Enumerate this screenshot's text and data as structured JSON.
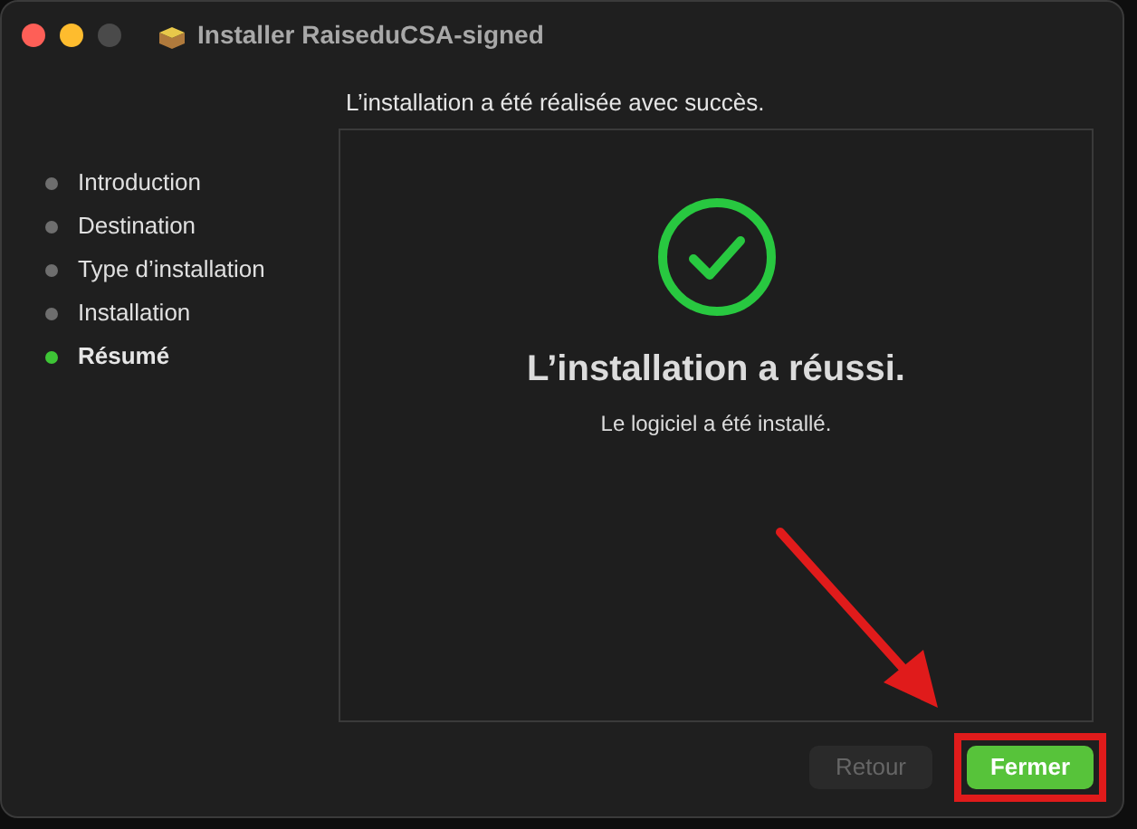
{
  "window": {
    "title": "Installer RaiseduCSA-signed"
  },
  "sidebar": {
    "items": [
      {
        "label": "Introduction",
        "selected": false
      },
      {
        "label": "Destination",
        "selected": false
      },
      {
        "label": "Type d’installation",
        "selected": false
      },
      {
        "label": "Installation",
        "selected": false
      },
      {
        "label": "Résumé",
        "selected": true
      }
    ]
  },
  "header": "L’installation a été réalisée avec succès.",
  "result": {
    "title": "L’installation a réussi.",
    "message": "Le logiciel a été installé."
  },
  "buttons": [
    {
      "label": "Retour",
      "disabled": true,
      "highlighted": false
    },
    {
      "label": "Fermer",
      "disabled": false,
      "highlighted": true
    }
  ]
}
